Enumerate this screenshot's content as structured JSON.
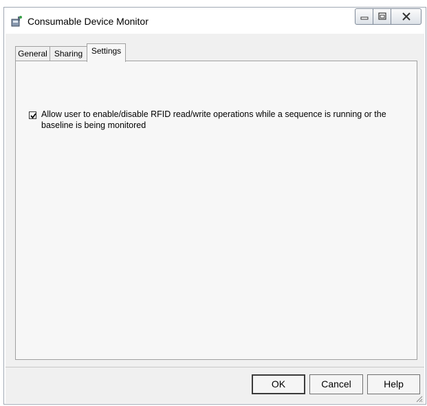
{
  "window": {
    "title": "Consumable Device Monitor"
  },
  "tabs": [
    {
      "label": "General",
      "active": false
    },
    {
      "label": "Sharing",
      "active": false
    },
    {
      "label": "Settings",
      "active": true
    }
  ],
  "settings": {
    "rfid_option": {
      "label": "Allow user to enable/disable RFID read/write operations while a sequence is running or the baseline is being monitored",
      "checked": true
    }
  },
  "buttons": {
    "ok": "OK",
    "cancel": "Cancel",
    "help": "Help"
  },
  "icons": {
    "app": "device-monitor-icon",
    "minimize": "minimize-icon",
    "maximize": "maximize-icon",
    "close": "close-icon"
  }
}
